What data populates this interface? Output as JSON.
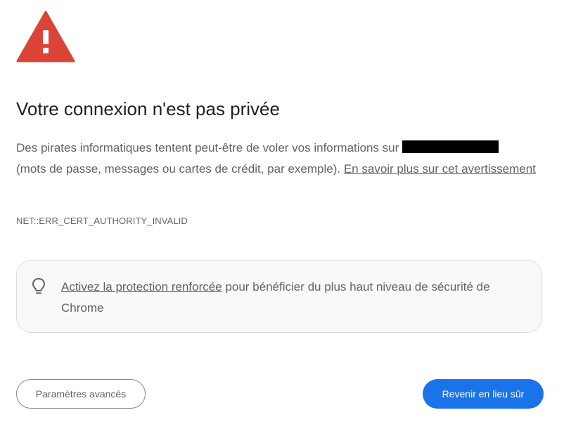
{
  "icons": {
    "warning": "warning-triangle-icon",
    "tip": "lightbulb-icon"
  },
  "colors": {
    "warning_red": "#db4437",
    "primary_button": "#1a73e8",
    "text_primary": "#202124",
    "text_secondary": "#5f6368"
  },
  "title": "Votre connexion n'est pas privée",
  "message": {
    "before_site": "Des pirates informatiques tentent peut-être de voler vos informations sur",
    "after_site": "(mots de passe, messages ou cartes de crédit, par exemple).",
    "learn_more_link": "En savoir plus sur cet avertissement"
  },
  "error_code": "NET::ERR_CERT_AUTHORITY_INVALID",
  "enhanced_protection": {
    "link": "Activez la protection renforcée",
    "text": "pour bénéficier du plus haut niveau de sécurité de Chrome"
  },
  "buttons": {
    "advanced": "Paramètres avancés",
    "back_to_safety": "Revenir en lieu sûr"
  }
}
